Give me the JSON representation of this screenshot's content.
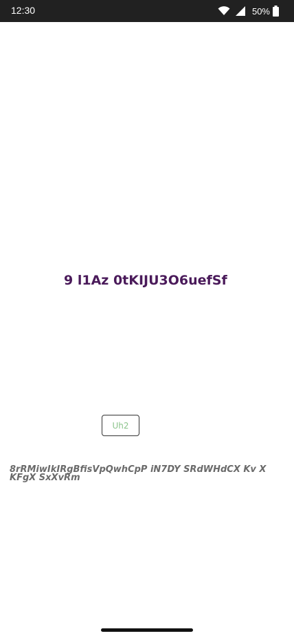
{
  "status_bar": {
    "time": "12:30",
    "battery_percent": "50%",
    "battery_level": 0.5,
    "icons": [
      "wifi-icon",
      "signal-icon",
      "battery-icon"
    ]
  },
  "main": {
    "headline": "9 l1Az 0tKIJU3O6uefSf",
    "button_label": "Uh2",
    "italic_text": "8rRMiwIkIRgBfisVpQwhCpP  iN7DY SRdWHdCX Kv X KFgX SxXvRm"
  },
  "colors": {
    "status_bar_bg": "#212121",
    "headline": "#4a1a5a",
    "button_text": "#8cc48c",
    "italic_text": "#6a6a6a"
  }
}
